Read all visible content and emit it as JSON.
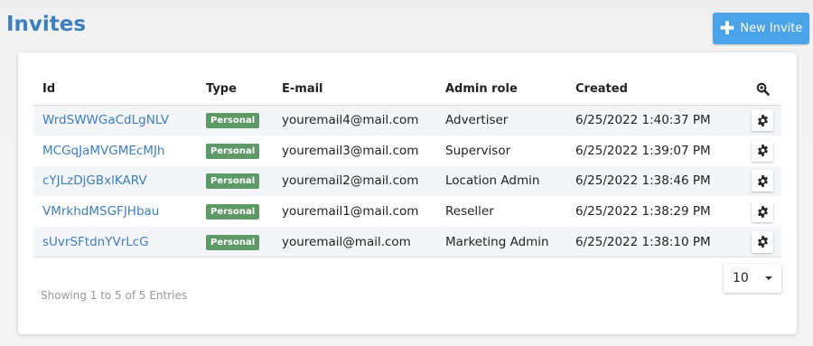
{
  "header": {
    "title": "Invites",
    "new_invite_label": "New Invite"
  },
  "table": {
    "columns": {
      "id": "Id",
      "type": "Type",
      "email": "E-mail",
      "admin_role": "Admin role",
      "created": "Created"
    },
    "rows": [
      {
        "id": "WrdSWWGaCdLgNLV",
        "type": "Personal",
        "email": "youremail4@mail.com",
        "role": "Advertiser",
        "created": "6/25/2022 1:40:37 PM"
      },
      {
        "id": "MCGqJaMVGMEcMJh",
        "type": "Personal",
        "email": "youremail3@mail.com",
        "role": "Supervisor",
        "created": "6/25/2022 1:39:07 PM"
      },
      {
        "id": "cYJLzDjGBxlKARV",
        "type": "Personal",
        "email": "youremail2@mail.com",
        "role": "Location Admin",
        "created": "6/25/2022 1:38:46 PM"
      },
      {
        "id": "VMrkhdMSGFJHbau",
        "type": "Personal",
        "email": "youremail1@mail.com",
        "role": "Reseller",
        "created": "6/25/2022 1:38:29 PM"
      },
      {
        "id": "sUvrSFtdnYVrLcG",
        "type": "Personal",
        "email": "youremail@mail.com",
        "role": "Marketing Admin",
        "created": "6/25/2022 1:38:10 PM"
      }
    ]
  },
  "footer": {
    "entries_text": "Showing 1 to 5 of 5 Entries",
    "page_size": "10"
  },
  "icons": {
    "search": "search-zoom-icon",
    "settings": "gear-icon",
    "add": "plus-icon",
    "dropdown": "caret-down-icon"
  },
  "colors": {
    "accent": "#3d7fbd",
    "button": "#4aa3e9",
    "badge": "#5e9a66"
  }
}
